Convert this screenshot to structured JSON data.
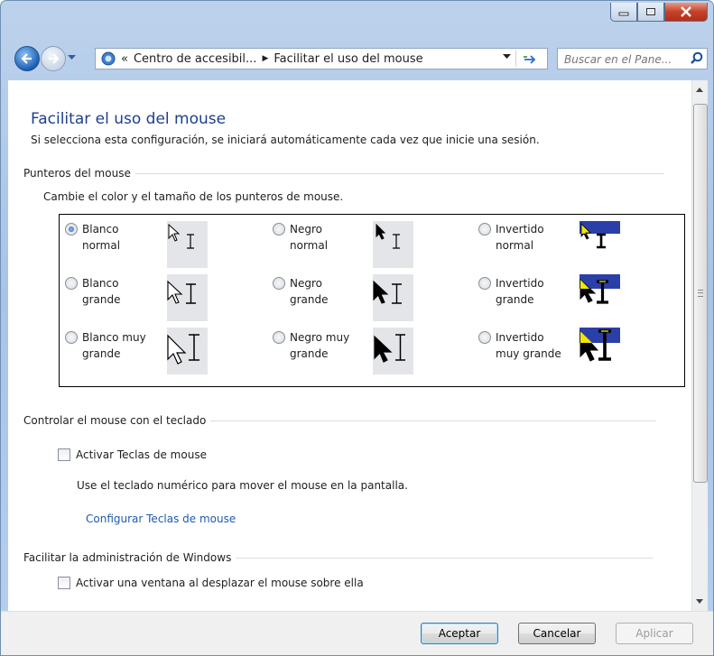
{
  "address": {
    "crumb1": "Centro de accesibil...",
    "crumb2": "Facilitar el uso del mouse",
    "overflow": "«"
  },
  "search": {
    "placeholder": "Buscar en el Pane..."
  },
  "page": {
    "title": "Facilitar el uso del mouse",
    "subtitle": "Si selecciona esta configuración, se iniciará automáticamente cada vez que inicie una sesión."
  },
  "pointers": {
    "section": "Punteros del mouse",
    "desc": "Cambie el color y el tamaño de los punteros de mouse.",
    "options": [
      {
        "l1": "Blanco",
        "l2": "normal",
        "selected": true
      },
      {
        "l1": "Negro",
        "l2": "normal",
        "selected": false
      },
      {
        "l1": "Invertido",
        "l2": "normal",
        "selected": false
      },
      {
        "l1": "Blanco",
        "l2": "grande",
        "selected": false
      },
      {
        "l1": "Negro",
        "l2": "grande",
        "selected": false
      },
      {
        "l1": "Invertido",
        "l2": "grande",
        "selected": false
      },
      {
        "l1": "Blanco muy",
        "l2": "grande",
        "selected": false
      },
      {
        "l1": "Negro muy",
        "l2": "grande",
        "selected": false
      },
      {
        "l1": "Invertido",
        "l2": "muy grande",
        "selected": false
      }
    ]
  },
  "keyboard": {
    "section": "Controlar el mouse con el teclado",
    "checkbox": "Activar Teclas de mouse",
    "desc": "Use el teclado numérico para mover el mouse en la pantalla.",
    "link": "Configurar Teclas de mouse"
  },
  "windows": {
    "section": "Facilitar la administración de Windows",
    "checkbox": "Activar una ventana al desplazar el mouse sobre ella"
  },
  "buttons": {
    "ok": "Aceptar",
    "cancel": "Cancelar",
    "apply": "Aplicar"
  },
  "colors": {
    "accent": "#1e3f8e",
    "link": "#1e5ab0",
    "inverted_bg": "#2b3fa8",
    "inverted_tip": "#f2e600"
  }
}
